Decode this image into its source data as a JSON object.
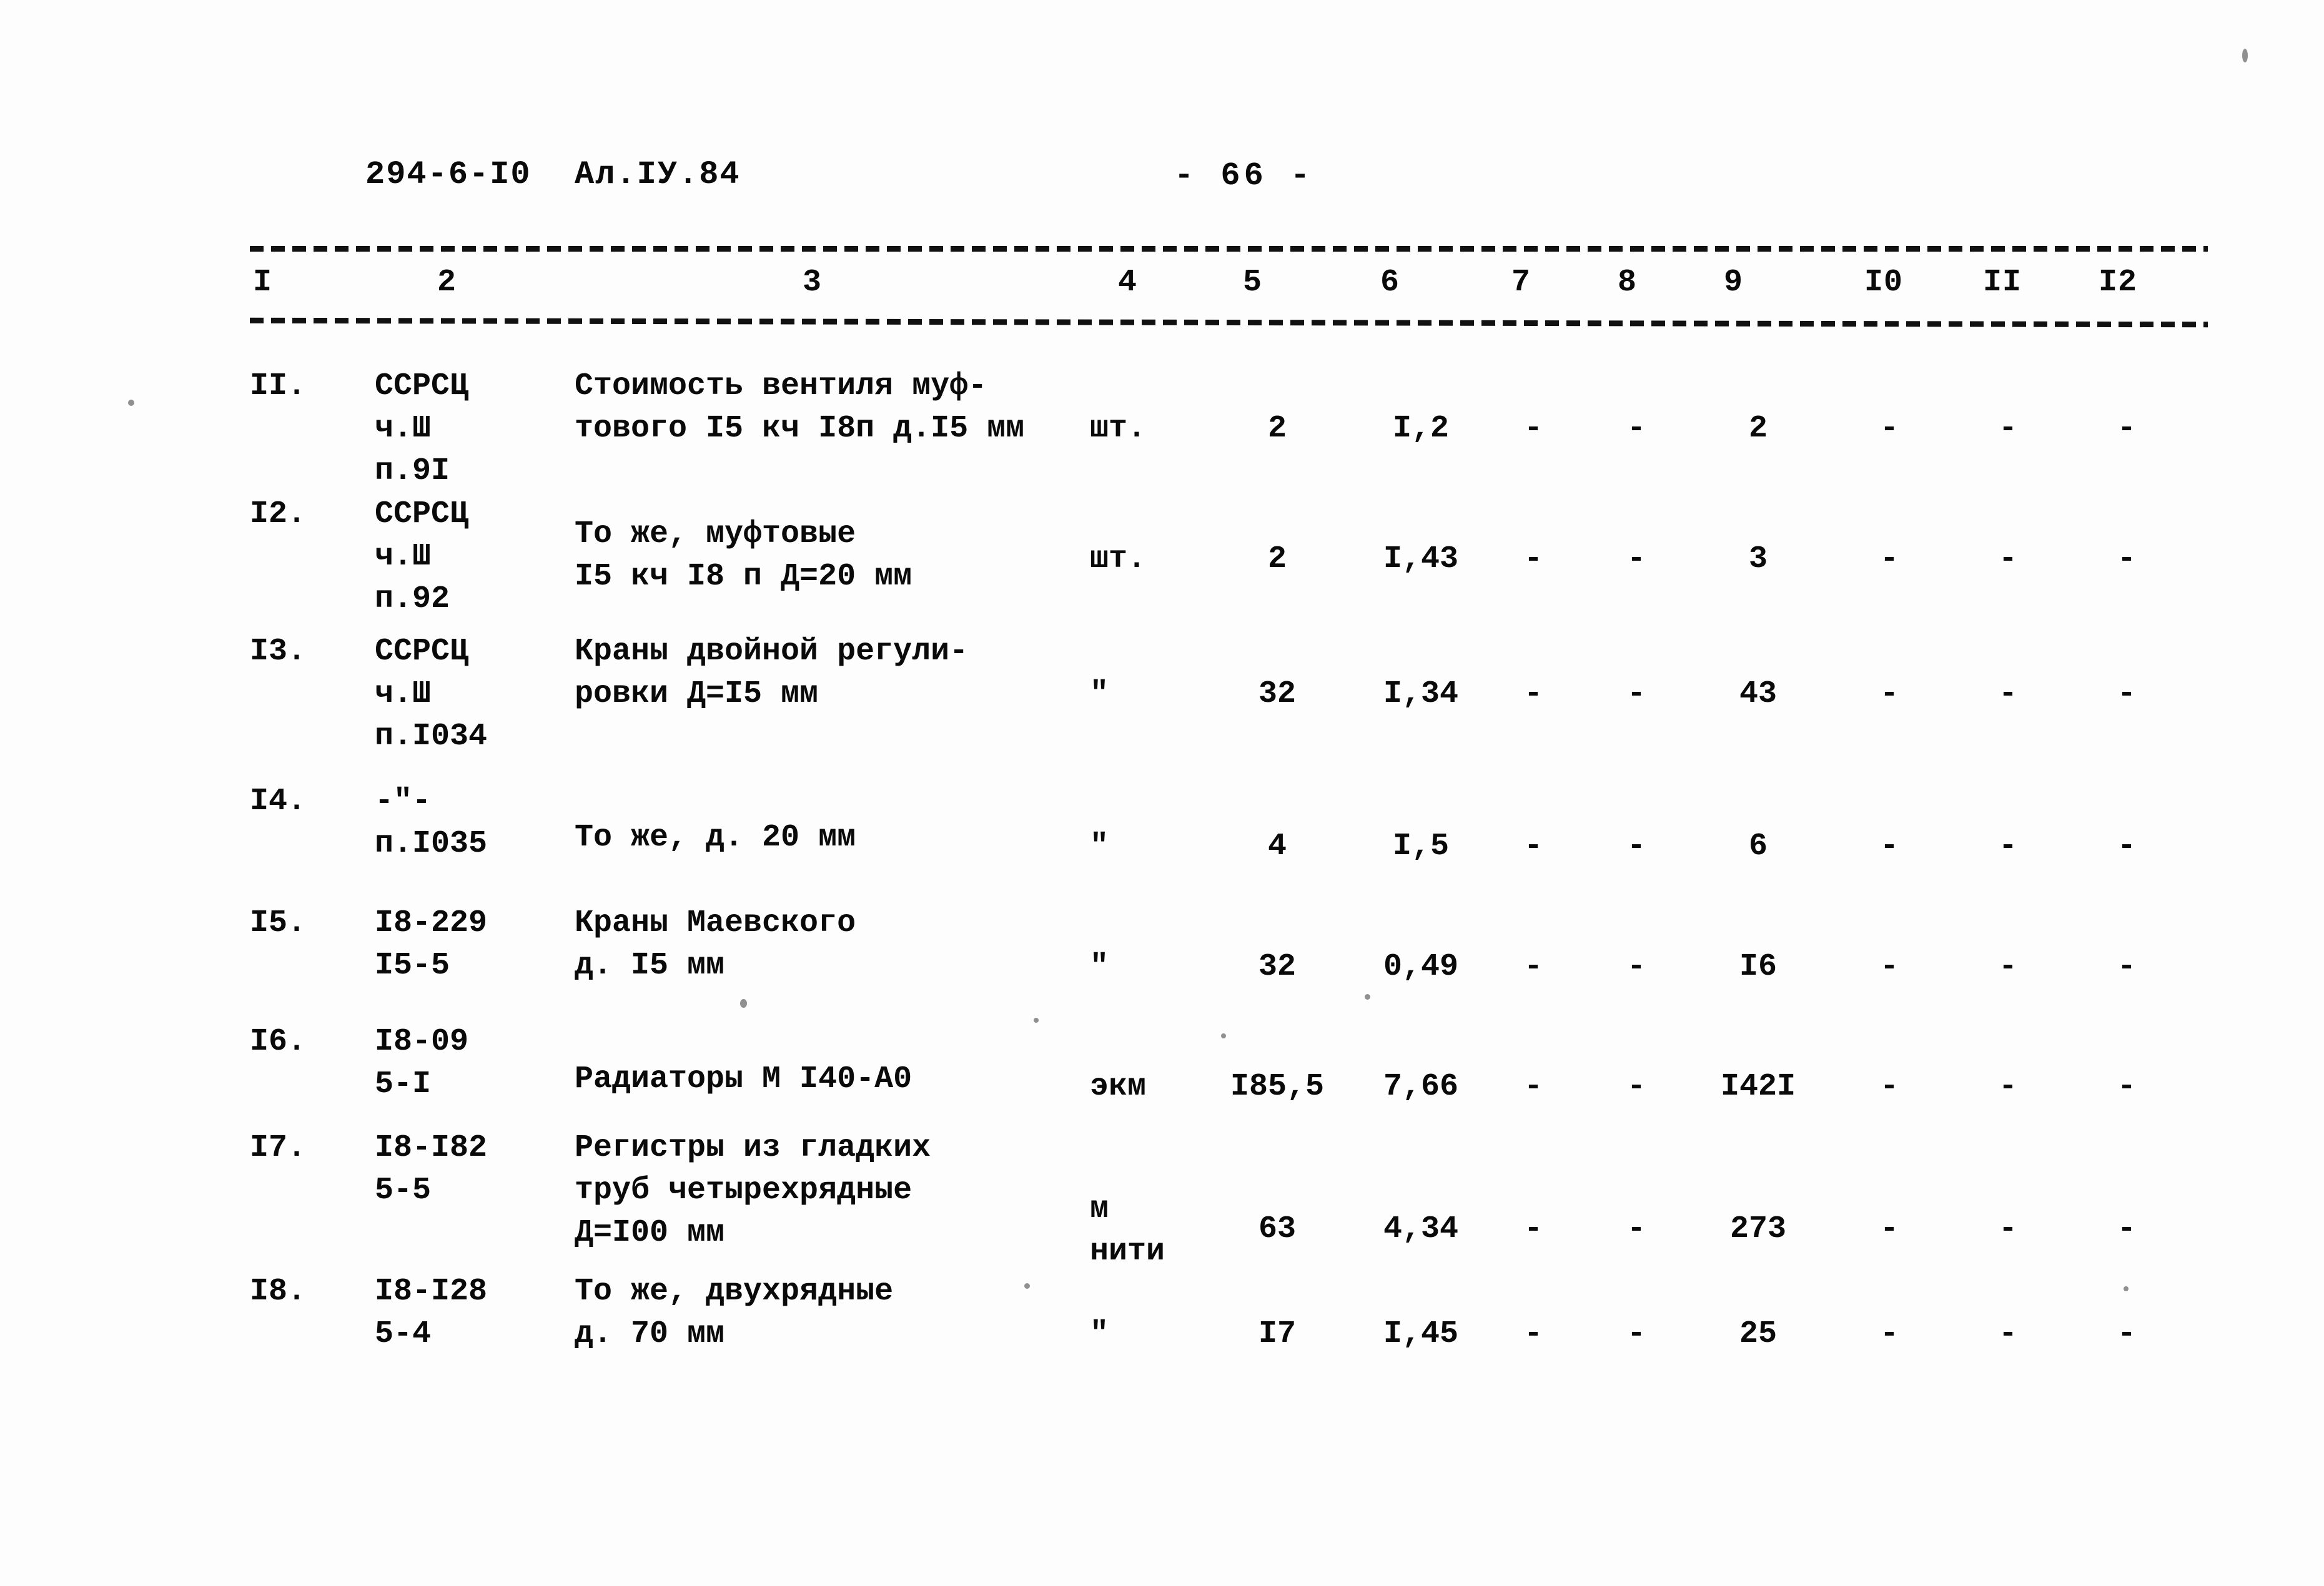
{
  "header": {
    "doc_code": "294-6-I0",
    "album": "Ал.IУ.84",
    "page_number": "- 66 -"
  },
  "table": {
    "column_headers": [
      "I",
      "2",
      "3",
      "4",
      "5",
      "6",
      "7",
      "8",
      "9",
      "I0",
      "II",
      "I2"
    ],
    "rows": [
      {
        "num": "II.",
        "code": "ССРСЦ\nч.Ш\nп.9I",
        "desc": "Стоимость вентиля муф-\nтового I5 кч I8п д.I5 мм",
        "unit": "шт.",
        "c5": "2",
        "c6": "I,2",
        "c7": "-",
        "c8": "-",
        "c9": "2",
        "c10": "-",
        "c11": "-",
        "c12": "-"
      },
      {
        "num": "I2.",
        "code": "ССРСЦ\nч.Ш\nп.92",
        "desc": "То же, муфтовые\nI5 кч I8 п Д=20 мм",
        "unit": "шт.",
        "c5": "2",
        "c6": "I,43",
        "c7": "-",
        "c8": "-",
        "c9": "3",
        "c10": "-",
        "c11": "-",
        "c12": "-"
      },
      {
        "num": "I3.",
        "code": "ССРСЦ\nч.Ш\nп.I034",
        "desc": "Краны двойной регули-\nровки Д=I5 мм",
        "unit": "\"",
        "c5": "32",
        "c6": "I,34",
        "c7": "-",
        "c8": "-",
        "c9": "43",
        "c10": "-",
        "c11": "-",
        "c12": "-"
      },
      {
        "num": "I4.",
        "code": "-\"-\nп.I035",
        "desc": "То же, д. 20 мм",
        "unit": "\"",
        "c5": "4",
        "c6": "I,5",
        "c7": "-",
        "c8": "-",
        "c9": "6",
        "c10": "-",
        "c11": "-",
        "c12": "-"
      },
      {
        "num": "I5.",
        "code": "I8-229\nI5-5",
        "desc": "Краны Маевского\nд. I5 мм",
        "unit": "\"",
        "c5": "32",
        "c6": "0,49",
        "c7": "-",
        "c8": "-",
        "c9": "I6",
        "c10": "-",
        "c11": "-",
        "c12": "-"
      },
      {
        "num": "I6.",
        "code": "I8-09\n5-I",
        "desc": "Радиаторы М I40-А0",
        "unit": "экм",
        "c5": "I85,5",
        "c6": "7,66",
        "c7": "-",
        "c8": "-",
        "c9": "I42I",
        "c10": "-",
        "c11": "-",
        "c12": "-"
      },
      {
        "num": "I7.",
        "code": "I8-I82\n5-5",
        "desc": "Регистры из гладких\nтруб четырехрядные\nД=I00 мм",
        "unit": "м\nнити",
        "c5": "63",
        "c6": "4,34",
        "c7": "-",
        "c8": "-",
        "c9": "273",
        "c10": "-",
        "c11": "-",
        "c12": "-"
      },
      {
        "num": "I8.",
        "code": "I8-I28\n5-4",
        "desc": "То же, двухрядные\nд. 70 мм",
        "unit": "\"",
        "c5": "I7",
        "c6": "I,45",
        "c7": "-",
        "c8": "-",
        "c9": "25",
        "c10": "-",
        "c11": "-",
        "c12": "-"
      }
    ]
  }
}
